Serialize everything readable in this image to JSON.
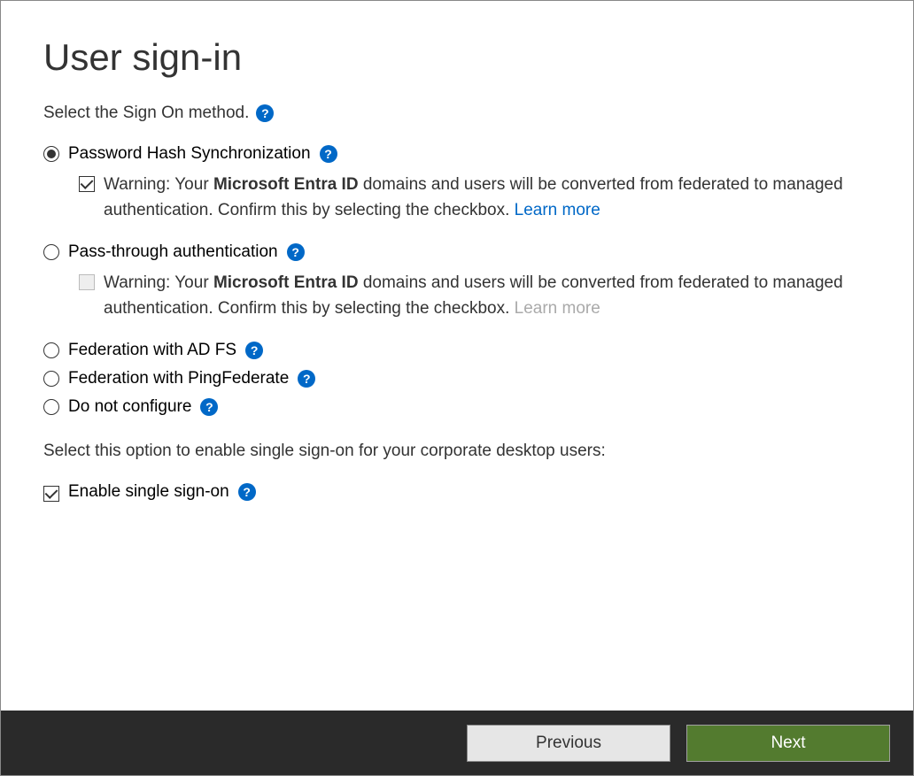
{
  "title": "User sign-in",
  "instruction": "Select the Sign On method.",
  "options": {
    "phs": {
      "label": "Password Hash Synchronization",
      "selected": true,
      "warning_prefix": "Warning: Your ",
      "warning_bold": "Microsoft Entra ID",
      "warning_suffix": " domains and users will be converted from federated to managed authentication. Confirm this by selecting the checkbox. ",
      "learn_more": "Learn more",
      "checkbox_checked": true
    },
    "pta": {
      "label": "Pass-through authentication",
      "selected": false,
      "warning_prefix": "Warning: Your ",
      "warning_bold": "Microsoft Entra ID",
      "warning_suffix": " domains and users will be converted from federated to managed authentication. Confirm this by selecting the checkbox. ",
      "learn_more": "Learn more",
      "checkbox_checked": false
    },
    "adfs": {
      "label": "Federation with AD FS",
      "selected": false
    },
    "ping": {
      "label": "Federation with PingFederate",
      "selected": false
    },
    "none": {
      "label": "Do not configure",
      "selected": false
    }
  },
  "sso": {
    "instruction": "Select this option to enable single sign-on for your corporate desktop users:",
    "label": "Enable single sign-on",
    "checked": true
  },
  "footer": {
    "previous": "Previous",
    "next": "Next"
  }
}
